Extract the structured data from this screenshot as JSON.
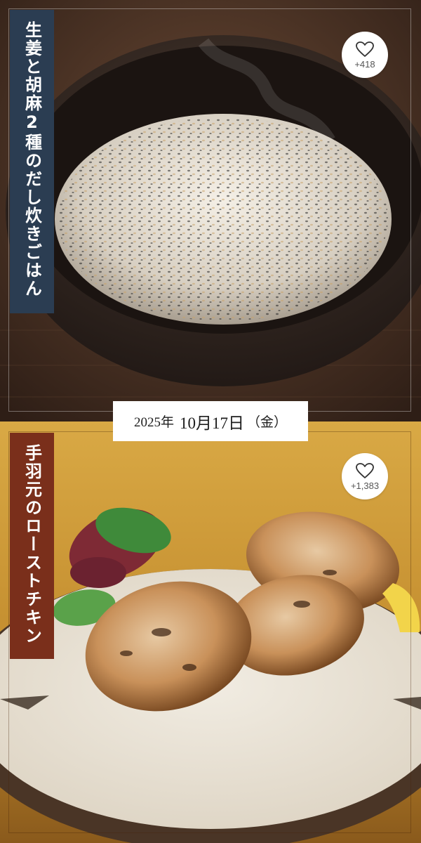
{
  "cards": [
    {
      "title": "生姜と胡麻2種のだし炊きごはん",
      "likes": "+418"
    },
    {
      "title": "手羽元のローストチキン",
      "likes": "+1,383"
    }
  ],
  "date": {
    "year": "2025年",
    "day": "10月17日",
    "weekday": "（金）"
  },
  "icons": {
    "like": "heart-outline-icon"
  },
  "colors": {
    "title_band_top": "#2b3d52",
    "title_band_bottom": "#7a2f1b",
    "bottom_background": "#c99a3a"
  }
}
